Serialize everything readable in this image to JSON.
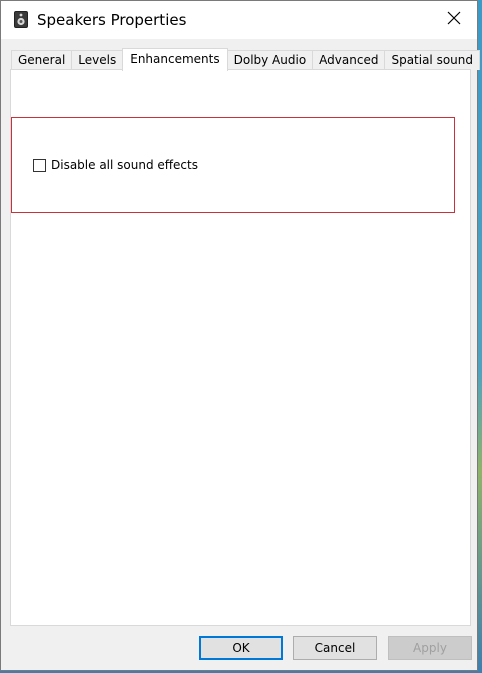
{
  "window": {
    "title": "Speakers Properties"
  },
  "icons": {
    "app": "speaker-icon",
    "close": "close-icon"
  },
  "tabs": [
    {
      "label": "General",
      "active": false
    },
    {
      "label": "Levels",
      "active": false
    },
    {
      "label": "Enhancements",
      "active": true
    },
    {
      "label": "Dolby Audio",
      "active": false
    },
    {
      "label": "Advanced",
      "active": false
    },
    {
      "label": "Spatial sound",
      "active": false
    }
  ],
  "enhancements": {
    "disable_all_label": "Disable all sound effects",
    "disable_all_checked": false
  },
  "buttons": {
    "ok": "OK",
    "cancel": "Cancel",
    "apply": "Apply"
  },
  "colors": {
    "highlight_border": "#c8323a",
    "default_button_border": "#0078d7"
  }
}
